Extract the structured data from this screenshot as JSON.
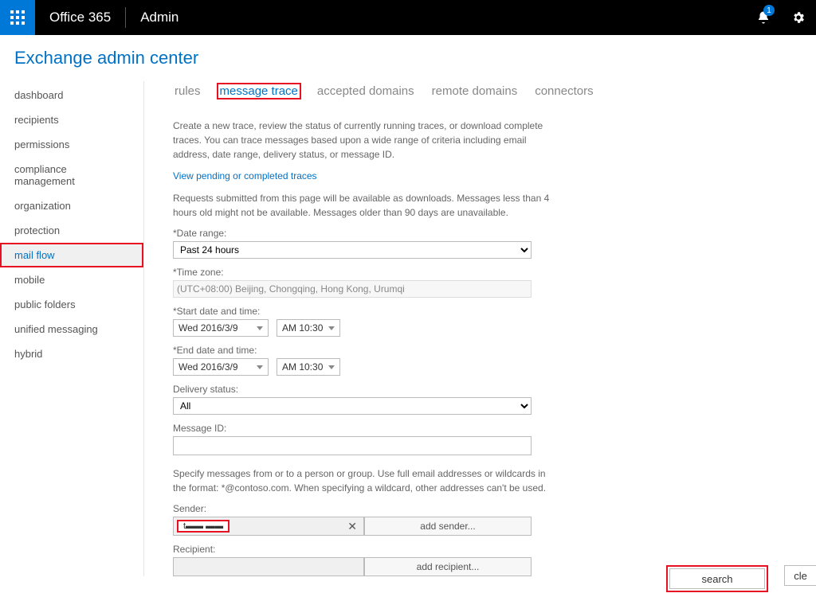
{
  "topbar": {
    "brand": "Office 365",
    "app": "Admin",
    "notification_count": "1"
  },
  "header": {
    "title": "Exchange admin center"
  },
  "sidebar": {
    "items": [
      "dashboard",
      "recipients",
      "permissions",
      "compliance management",
      "organization",
      "protection",
      "mail flow",
      "mobile",
      "public folders",
      "unified messaging",
      "hybrid"
    ],
    "active_index": 6
  },
  "tabs": {
    "items": [
      "rules",
      "message trace",
      "accepted domains",
      "remote domains",
      "connectors"
    ],
    "active_index": 1
  },
  "content": {
    "description1": "Create a new trace, review the status of currently running traces, or download complete traces. You can trace messages based upon a wide range of criteria including email address, date range, delivery status, or message ID.",
    "link_pending": "View pending or completed traces",
    "description2": "Requests submitted from this page will be available as downloads. Messages less than 4 hours old might not be available. Messages older than 90 days are unavailable.",
    "labels": {
      "date_range": "*Date range:",
      "time_zone": "*Time zone:",
      "start_dt": "*Start date and time:",
      "end_dt": "*End date and time:",
      "delivery_status": "Delivery status:",
      "message_id": "Message ID:",
      "specify_help": "Specify messages from or to a person or group. Use full email addresses or wildcards in the format: *@contoso.com. When specifying a wildcard, other addresses can't be used.",
      "sender": "Sender:",
      "recipient": "Recipient:"
    },
    "values": {
      "date_range": "Past 24 hours",
      "time_zone": "(UTC+08:00) Beijing, Chongqing, Hong Kong, Urumqi",
      "start_date": "Wed 2016/3/9",
      "start_time": "AM 10:30",
      "end_date": "Wed 2016/3/9",
      "end_time": "AM 10:30",
      "delivery_status": "All",
      "message_id": "",
      "sender_pill": "t▬▬ ▬▬",
      "add_sender": "add sender...",
      "add_recipient": "add recipient..."
    },
    "buttons": {
      "search": "search",
      "clear": "cle"
    }
  }
}
